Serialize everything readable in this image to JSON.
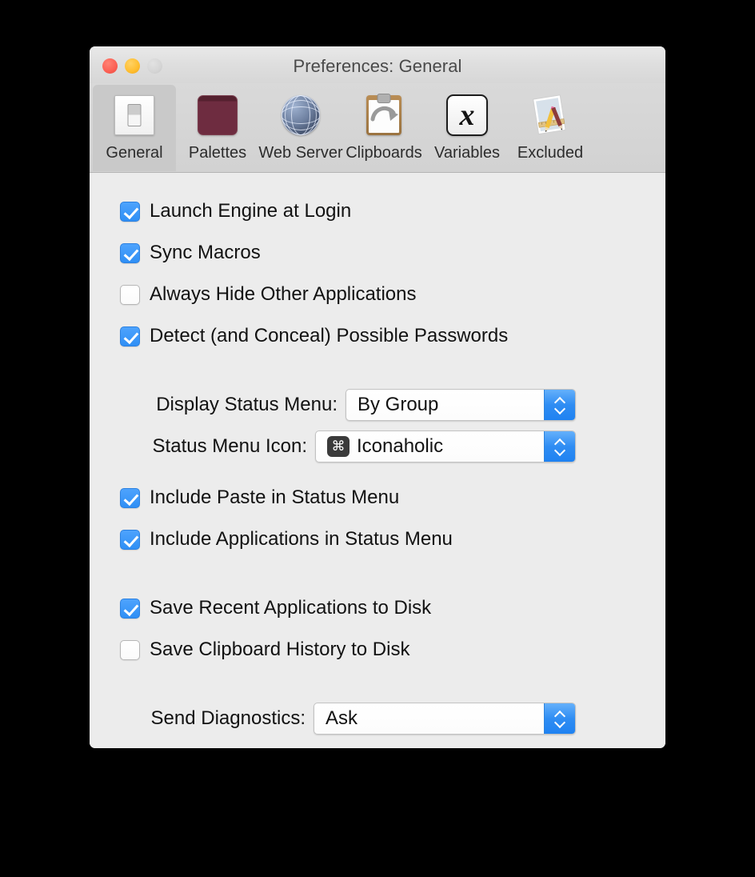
{
  "window": {
    "title": "Preferences: General",
    "traffic_lights": [
      {
        "name": "close",
        "color": "#fb5f53"
      },
      {
        "name": "minimize",
        "color": "#ffbd2e"
      },
      {
        "name": "zoom",
        "color": "#d5d5d5"
      }
    ]
  },
  "toolbar": {
    "selected": "General",
    "items": [
      {
        "label": "General",
        "icon": "light-switch-icon"
      },
      {
        "label": "Palettes",
        "icon": "palette-book-icon"
      },
      {
        "label": "Web Server",
        "icon": "globe-icon"
      },
      {
        "label": "Clipboards",
        "icon": "clipboard-arrow-icon"
      },
      {
        "label": "Variables",
        "icon": "italic-x-icon"
      },
      {
        "label": "Excluded",
        "icon": "paper-pencil-ruler-icon"
      }
    ]
  },
  "settings": {
    "group1": [
      {
        "label": "Launch Engine at Login",
        "checked": true
      },
      {
        "label": "Sync Macros",
        "checked": true
      },
      {
        "label": "Always Hide Other Applications",
        "checked": false
      },
      {
        "label": "Detect (and Conceal) Possible Passwords",
        "checked": true
      }
    ],
    "popup_display_status_menu": {
      "label": "Display Status Menu:",
      "value": "By Group"
    },
    "popup_status_menu_icon": {
      "label": "Status Menu Icon:",
      "value": "Iconaholic",
      "chip_glyph": "⌘"
    },
    "group2": [
      {
        "label": "Include Paste in Status Menu",
        "checked": true
      },
      {
        "label": "Include Applications in Status Menu",
        "checked": true
      }
    ],
    "group3": [
      {
        "label": "Save Recent Applications to Disk",
        "checked": true
      },
      {
        "label": "Save Clipboard History to Disk",
        "checked": false
      }
    ],
    "popup_send_diagnostics": {
      "label": "Send Diagnostics:",
      "value": "Ask"
    }
  },
  "colors": {
    "accent_blue": "#2f8ff5",
    "window_bg": "#ececec",
    "toolbar_bg": "#d4d4d4",
    "selected_tab_bg": "#c9c9c9"
  }
}
